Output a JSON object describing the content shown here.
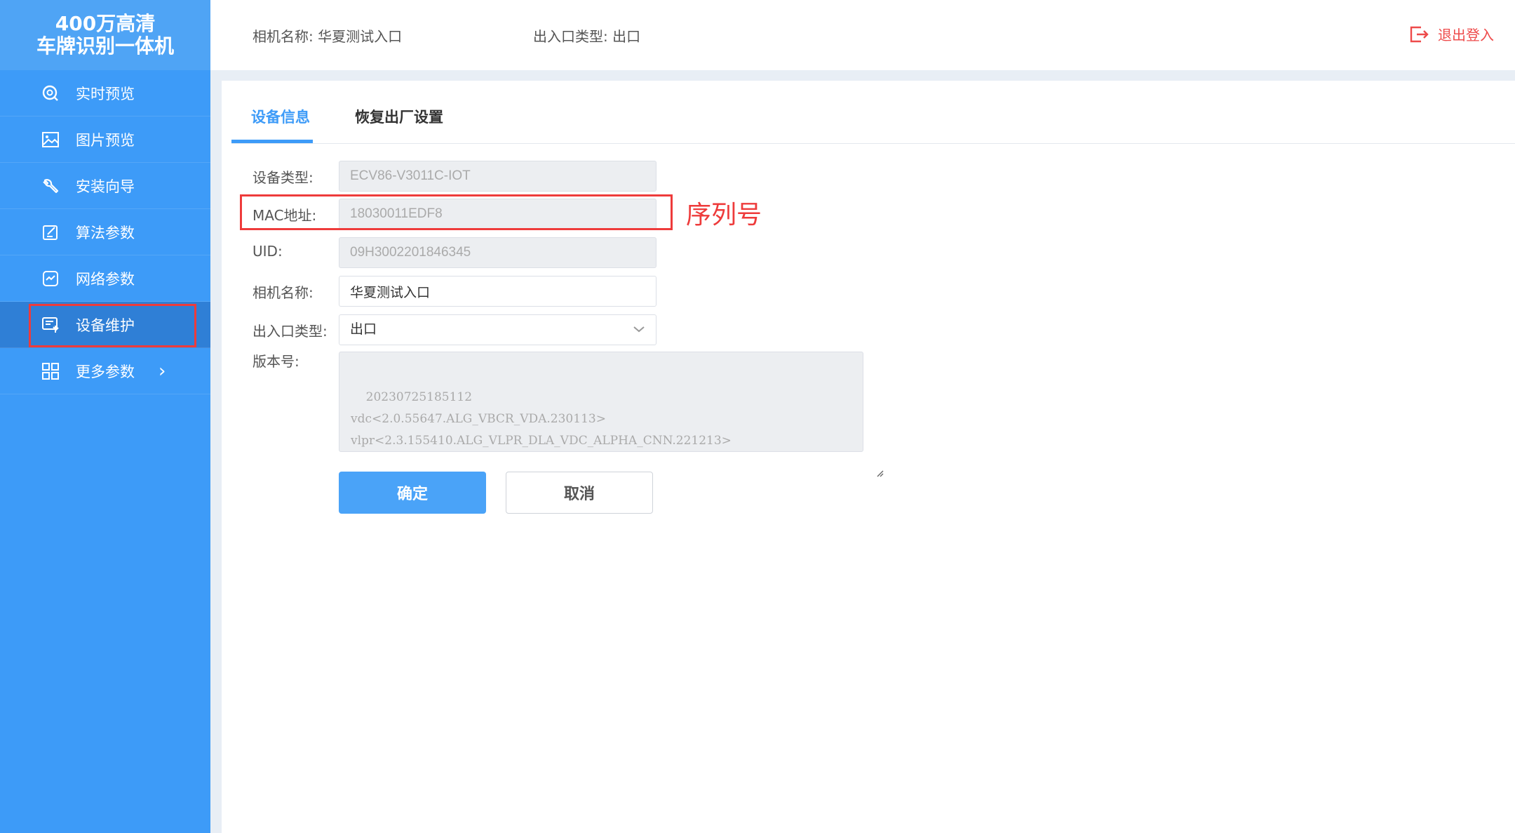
{
  "brand": {
    "line1": "400万高清",
    "line2": "车牌识别一体机"
  },
  "sidebar": {
    "items": [
      {
        "label": "实时预览",
        "icon": "live-preview-icon"
      },
      {
        "label": "图片预览",
        "icon": "image-icon"
      },
      {
        "label": "安装向导",
        "icon": "wrench-icon"
      },
      {
        "label": "算法参数",
        "icon": "edit-icon"
      },
      {
        "label": "网络参数",
        "icon": "network-icon"
      },
      {
        "label": "设备维护",
        "icon": "maintenance-icon",
        "active": true
      },
      {
        "label": "更多参数",
        "icon": "grid-icon"
      }
    ]
  },
  "header": {
    "camera_name": "相机名称: 华夏测试入口",
    "gate_type": "出入口类型: 出口",
    "logout_label": "退出登入"
  },
  "tabs": [
    {
      "label": "设备信息",
      "active": true
    },
    {
      "label": "恢复出厂设置",
      "active": false
    }
  ],
  "form": {
    "device_type": {
      "label": "设备类型:",
      "value": "ECV86-V3011C-IOT"
    },
    "mac": {
      "label": "MAC地址:",
      "value": "18030011EDF8"
    },
    "uid": {
      "label": "UID:",
      "value": "09H3002201846345"
    },
    "camera_name": {
      "label": "相机名称:",
      "value": "华夏测试入口"
    },
    "gate_type": {
      "label": "出入口类型:",
      "value": "出口"
    },
    "version": {
      "label": "版本号:",
      "value": "20230725185112\nvdc<2.0.55647.ALG_VBCR_VDA.230113>\nvlpr<2.3.155410.ALG_VLPR_DLA_VDC_ALPHA_CNN.221213>"
    }
  },
  "buttons": {
    "confirm": "确定",
    "cancel": "取消"
  },
  "annotation": {
    "text": "序列号"
  },
  "colors": {
    "primary": "#3d9bf8",
    "danger": "#ee3b3b"
  }
}
